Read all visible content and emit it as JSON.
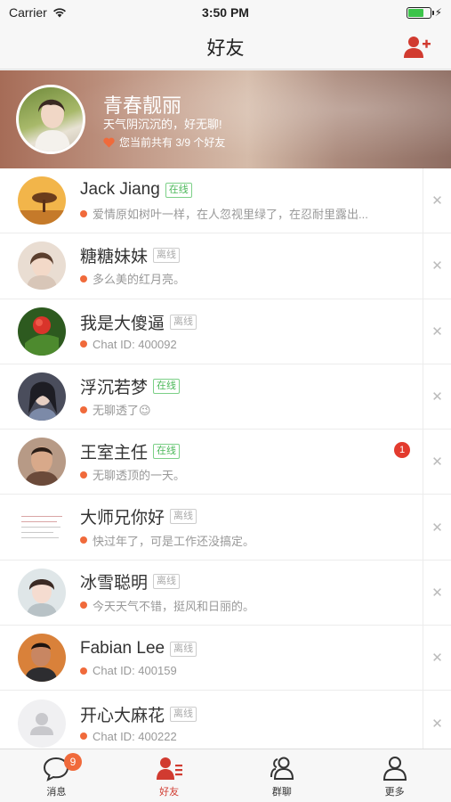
{
  "status_bar": {
    "carrier": "Carrier",
    "time": "3:50 PM",
    "battery_level": 0.75
  },
  "nav": {
    "title": "好友",
    "add_icon": "add-friend-icon"
  },
  "profile": {
    "name": "青春靓丽",
    "signature": "天气阴沉沉的，好无聊!",
    "friend_count": "您当前共有 3/9 个好友"
  },
  "friends": [
    {
      "name": "Jack Jiang",
      "status": "在线",
      "online": true,
      "subtitle": "爱情原如树叶一样，在人忽视里绿了，在忍耐里露出...",
      "unread": ""
    },
    {
      "name": "糖糖妹妹",
      "status": "离线",
      "online": false,
      "subtitle": "多么美的红月亮。",
      "unread": ""
    },
    {
      "name": "我是大傻逼",
      "status": "离线",
      "online": false,
      "subtitle": "Chat ID: 400092",
      "unread": ""
    },
    {
      "name": "浮沉若梦",
      "status": "在线",
      "online": true,
      "subtitle": "无聊透了😉",
      "unread": ""
    },
    {
      "name": "王室主任",
      "status": "在线",
      "online": true,
      "subtitle": "无聊透顶的一天。",
      "unread": "1"
    },
    {
      "name": "大师兄你好",
      "status": "离线",
      "online": false,
      "subtitle": "快过年了，可是工作还没搞定。",
      "unread": ""
    },
    {
      "name": "冰雪聪明",
      "status": "离线",
      "online": false,
      "subtitle": "今天天气不错，挺风和日丽的。",
      "unread": ""
    },
    {
      "name": "Fabian Lee",
      "status": "离线",
      "online": false,
      "subtitle": "Chat ID: 400159",
      "unread": ""
    },
    {
      "name": "开心大麻花",
      "status": "离线",
      "online": false,
      "subtitle": "Chat ID: 400222",
      "unread": ""
    }
  ],
  "tabs": [
    {
      "label": "消息",
      "icon": "chat-bubble-icon",
      "badge": "9",
      "active": false
    },
    {
      "label": "好友",
      "icon": "contacts-icon",
      "badge": "",
      "active": true
    },
    {
      "label": "群聊",
      "icon": "group-icon",
      "badge": "",
      "active": false
    },
    {
      "label": "更多",
      "icon": "person-more-icon",
      "badge": "",
      "active": false
    }
  ],
  "colors": {
    "accent": "#d13b30",
    "online": "#4cb85a",
    "dot": "#f06a3b"
  }
}
